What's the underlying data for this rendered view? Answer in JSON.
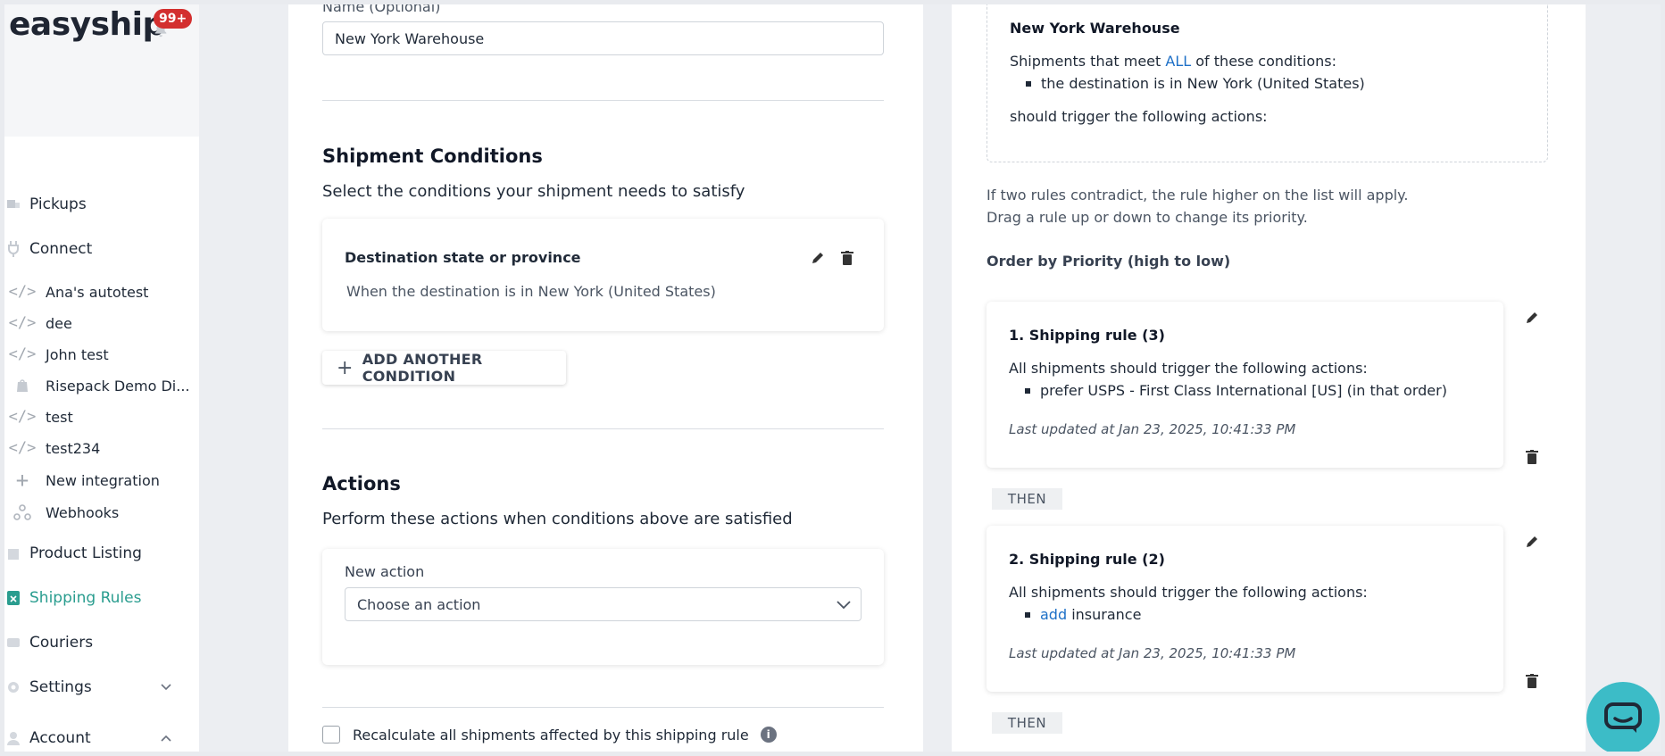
{
  "brand": {
    "logo": "easyship",
    "notifications_badge": "99+"
  },
  "sidebar": {
    "items": [
      {
        "label": "Pickups",
        "icon": "truck-icon"
      },
      {
        "label": "Connect",
        "icon": "plug-icon"
      }
    ],
    "integrations": [
      {
        "label": "Ana's autotest",
        "icon": "code-icon"
      },
      {
        "label": "dee",
        "icon": "code-icon"
      },
      {
        "label": "John test",
        "icon": "code-icon"
      },
      {
        "label": "Risepack Demo Di...",
        "icon": "shopify-icon"
      },
      {
        "label": "test",
        "icon": "code-icon"
      },
      {
        "label": "test234",
        "icon": "code-icon"
      },
      {
        "label": "New integration",
        "icon": "plus-icon"
      },
      {
        "label": "Webhooks",
        "icon": "webhook-icon"
      }
    ],
    "bottom_items": [
      {
        "label": "Product Listing",
        "icon": "box-icon"
      },
      {
        "label": "Shipping Rules",
        "icon": "rules-icon",
        "active": true
      },
      {
        "label": "Couriers",
        "icon": "courier-icon"
      },
      {
        "label": "Settings",
        "icon": "gear-icon",
        "chevron": "down"
      },
      {
        "label": "Account",
        "icon": "user-icon",
        "chevron": "up"
      }
    ],
    "active_color": "#2a9d8f"
  },
  "form": {
    "name_label": "Name (Optional)",
    "name_value": "New York Warehouse",
    "conditions_heading": "Shipment Conditions",
    "conditions_sub": "Select the conditions your shipment needs to satisfy",
    "condition": {
      "title": "Destination state or province",
      "description": "When the destination is in New York (United States)"
    },
    "add_condition_label": "ADD ANOTHER CONDITION",
    "actions_heading": "Actions",
    "actions_sub": "Perform these actions when conditions above are satisfied",
    "new_action_label": "New action",
    "action_select_value": "Choose an action",
    "recalculate_label": "Recalculate all shipments affected by this shipping rule",
    "recalculate_checked": false
  },
  "preview": {
    "title": "New York Warehouse",
    "meet_prefix": "Shipments that meet",
    "meet_keyword": "ALL",
    "meet_suffix": "of these conditions:",
    "condition_bullet": "the destination is in New York (United States)",
    "trigger_text": "should trigger the following actions:",
    "note_line1": "If two rules contradict, the rule higher on the list will apply.",
    "note_line2": "Drag a rule up or down to change its priority.",
    "order_label": "Order by Priority (high to low)",
    "then_label": "THEN",
    "rules": [
      {
        "title": "1. Shipping rule (3)",
        "line": "All shipments should trigger the following actions:",
        "bullet_prefix": "",
        "bullet_text": "prefer USPS - First Class International [US] (in that order)",
        "updated": "Last updated at Jan 23, 2025, 10:41:33 PM"
      },
      {
        "title": "2. Shipping rule (2)",
        "line": "All shipments should trigger the following actions:",
        "bullet_prefix": "add",
        "bullet_text": "insurance",
        "updated": "Last updated at Jan 23, 2025, 10:41:33 PM"
      }
    ],
    "link_color": "#1e70c7"
  },
  "chat": {
    "icon": "chat-icon",
    "color": "#3cbcc7"
  }
}
